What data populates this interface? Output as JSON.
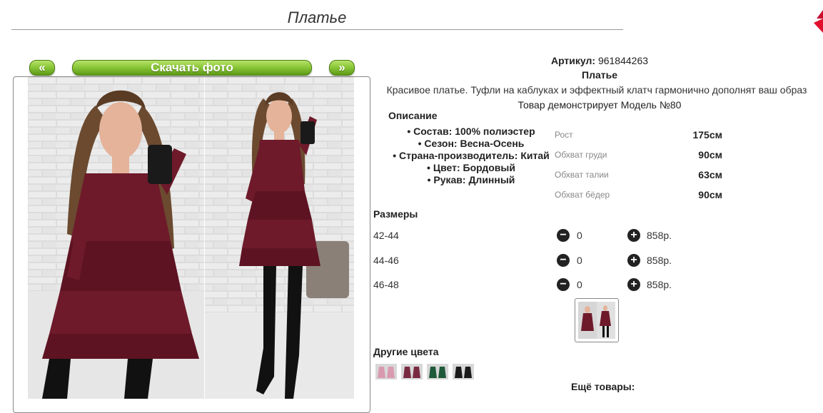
{
  "page": {
    "title": "Платье"
  },
  "gallery": {
    "prev_label": "«",
    "download_label": "Скачать фото",
    "next_label": "»"
  },
  "product": {
    "article_label": "Артикул:",
    "article_value": "961844263",
    "name": "Платье",
    "description": "Красивое платье. Туфли на каблуках и эффектный клатч гармонично дополнят ваш образ",
    "model_line": "Товар демонстрирует Модель №80"
  },
  "description_section": {
    "heading": "Описание",
    "items": [
      "Состав: 100% полиэстер",
      "Сезон: Весна-Осень",
      "Страна-производитель: Китай",
      "Цвет: Бордовый",
      "Рукав: Длинный"
    ]
  },
  "measurements": [
    {
      "label": "Рост",
      "value": "175см"
    },
    {
      "label": "Обхват груди",
      "value": "90см"
    },
    {
      "label": "Обхват талии",
      "value": "63см"
    },
    {
      "label": "Обхват бёдер",
      "value": "90см"
    }
  ],
  "sizes": {
    "heading": "Размеры",
    "rows": [
      {
        "size": "42-44",
        "qty": "0",
        "price": "858р."
      },
      {
        "size": "44-46",
        "qty": "0",
        "price": "858р."
      },
      {
        "size": "46-48",
        "qty": "0",
        "price": "858р."
      }
    ]
  },
  "other_colors": {
    "heading": "Другие цвета"
  },
  "more_products": {
    "heading": "Ещё товары:"
  },
  "colors": {
    "button_green": "#8cc83a",
    "dress_color": "#6e1a2a",
    "brick_bg": "#d9d9d9"
  }
}
